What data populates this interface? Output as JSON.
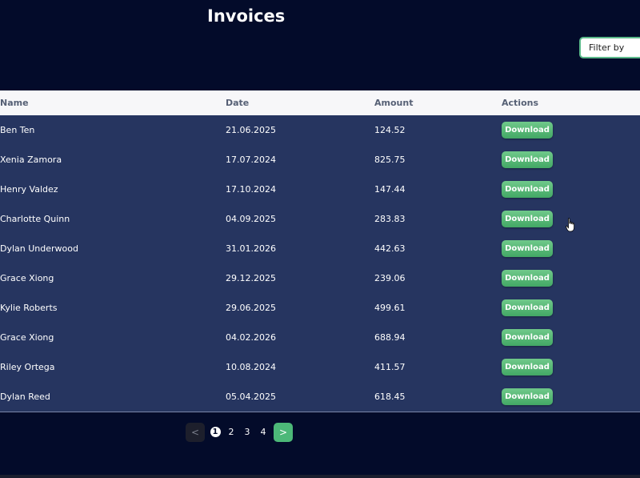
{
  "header": {
    "title": "Invoices",
    "filter_placeholder": "Filter by"
  },
  "table": {
    "columns": [
      "Name",
      "Date",
      "Amount",
      "Actions"
    ],
    "rows": [
      {
        "name": "Ben Ten",
        "date": "21.06.2025",
        "amount": "124.52",
        "action": "Download"
      },
      {
        "name": "Xenia Zamora",
        "date": "17.07.2024",
        "amount": "825.75",
        "action": "Download"
      },
      {
        "name": "Henry Valdez",
        "date": "17.10.2024",
        "amount": "147.44",
        "action": "Download"
      },
      {
        "name": "Charlotte Quinn",
        "date": "04.09.2025",
        "amount": "283.83",
        "action": "Download"
      },
      {
        "name": "Dylan Underwood",
        "date": "31.01.2026",
        "amount": "442.63",
        "action": "Download"
      },
      {
        "name": "Grace Xiong",
        "date": "29.12.2025",
        "amount": "239.06",
        "action": "Download"
      },
      {
        "name": "Kylie Roberts",
        "date": "29.06.2025",
        "amount": "499.61",
        "action": "Download"
      },
      {
        "name": "Grace Xiong",
        "date": "04.02.2026",
        "amount": "688.94",
        "action": "Download"
      },
      {
        "name": "Riley Ortega",
        "date": "10.08.2024",
        "amount": "411.57",
        "action": "Download"
      },
      {
        "name": "Dylan Reed",
        "date": "05.04.2025",
        "amount": "618.45",
        "action": "Download"
      }
    ]
  },
  "pagination": {
    "prev": "<",
    "next": ">",
    "pages": [
      "1",
      "2",
      "3",
      "4"
    ],
    "current": "1"
  },
  "colors": {
    "background": "#030b2a",
    "table_body": "#263560",
    "header_bg": "#f7f7f9",
    "accent": "#4cb878"
  }
}
